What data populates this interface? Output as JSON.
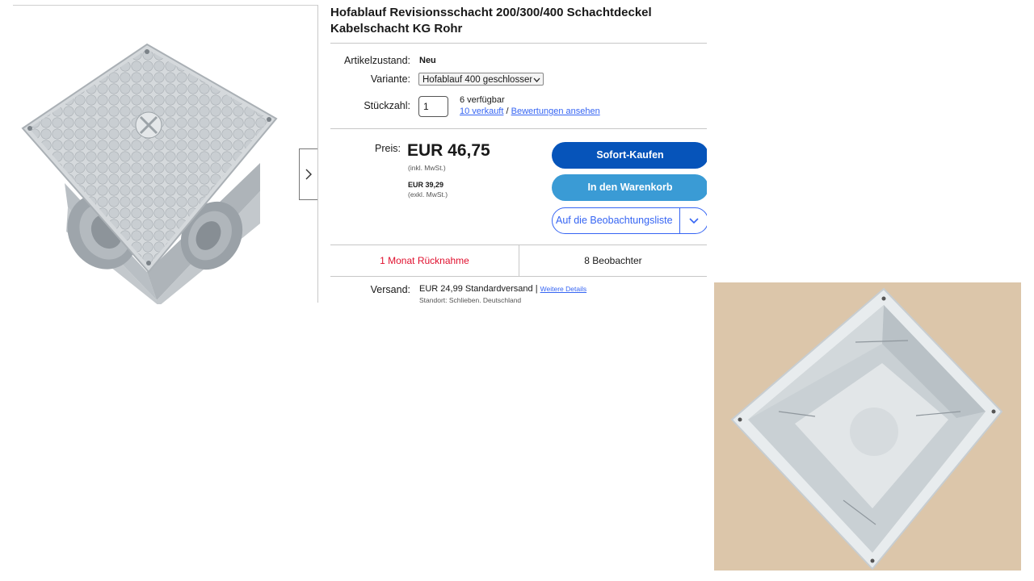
{
  "listing": {
    "title": "Hofablauf Revisionsschacht 200/300/400 Schachtdeckel Kabelschacht KG Rohr",
    "condition_label": "Artikelzustand:",
    "condition_value": "Neu",
    "variant_label": "Variante:",
    "variant_value": "Hofablauf 400 geschlossen",
    "qty_label": "Stückzahl:",
    "qty_value": "1",
    "available": "6 verfügbar",
    "sold": "10 verkauft",
    "slash": "/",
    "reviews": "Bewertungen ansehen",
    "price_label": "Preis:",
    "price": "EUR 46,75",
    "price_note": "(inkl. MwSt.)",
    "price_net": "EUR 39,29",
    "price_net_note": "(exkl. MwSt.)",
    "buy_now": "Sofort-Kaufen",
    "add_to_cart": "In den Warenkorb",
    "watchlist": "Auf die Beobachtungsliste",
    "returns": "1 Monat Rücknahme",
    "watchers": "8 Beobachter",
    "shipping_label": "Versand:",
    "shipping_value": "EUR 24,99 Standardversand |",
    "shipping_link": "Weitere Details",
    "location": "Standort: Schlieben, Deutschland"
  },
  "colors": {
    "buy_button": "#0654ba",
    "cart_button": "#3a9bd5",
    "link": "#3665f3",
    "returns_text": "#e0102e"
  },
  "icons": {
    "next": "chevron-right-icon",
    "variant_dropdown": "chevron-down-icon",
    "watchlist_dropdown": "chevron-down-icon"
  }
}
